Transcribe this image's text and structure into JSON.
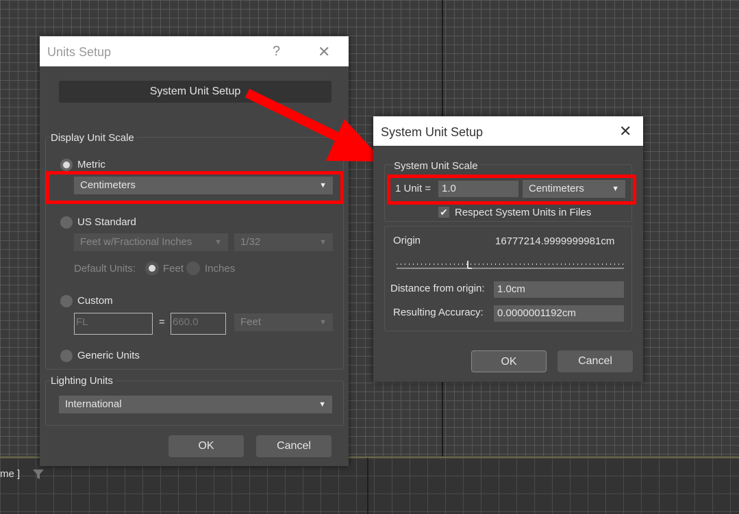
{
  "background": {
    "frame_label": "me ]",
    "filter_icon": "filter-icon"
  },
  "units_dialog": {
    "title": "Units Setup",
    "help_icon": "?",
    "close_icon": "✕",
    "system_unit_button": "System Unit Setup",
    "display_unit_scale": {
      "title": "Display Unit Scale",
      "metric_label": "Metric",
      "metric_selected": "Centimeters",
      "us_standard_label": "US Standard",
      "us_units": "Feet w/Fractional Inches",
      "us_fraction": "1/32",
      "default_units_label": "Default Units:",
      "feet_label": "Feet",
      "inches_label": "Inches",
      "custom_label": "Custom",
      "custom_name": "FL",
      "equals": "=",
      "custom_value": "660.0",
      "custom_unit": "Feet",
      "generic_label": "Generic Units"
    },
    "lighting_units": {
      "title": "Lighting Units",
      "selected": "International"
    },
    "ok": "OK",
    "cancel": "Cancel"
  },
  "system_dialog": {
    "title": "System Unit Setup",
    "close_icon": "✕",
    "scale": {
      "title": "System Unit Scale",
      "unit_label": "1 Unit =",
      "unit_value": "1.0",
      "unit_type": "Centimeters",
      "respect_label": "Respect System Units in Files",
      "respect_checked": true
    },
    "origin": {
      "label": "Origin",
      "value": "16777214.9999999981cm",
      "distance_label": "Distance from origin:",
      "distance_value": "1.0cm",
      "accuracy_label": "Resulting Accuracy:",
      "accuracy_value": "0.0000001192cm"
    },
    "ok": "OK",
    "cancel": "Cancel"
  },
  "annotation": {
    "color": "#ff0000"
  },
  "colors": {
    "dialog_bg": "#444444",
    "viewport_bg": "#3b3b3b",
    "highlight": "#ff0000"
  }
}
